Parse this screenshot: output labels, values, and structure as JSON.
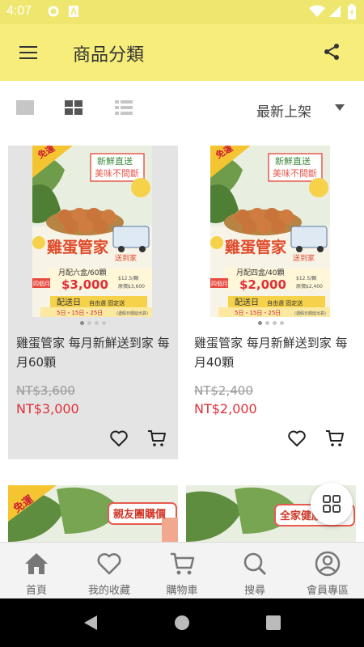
{
  "status_bar": {
    "time": "4:07"
  },
  "app_bar": {
    "title": "商品分類"
  },
  "toolbar": {
    "sort_label": "最新上架"
  },
  "products": [
    {
      "name": "雞蛋管家 每月新鮮送到家 每月60顆",
      "original_price": "NT$3,600",
      "price": "NT$3,000",
      "image": {
        "badge": "免運",
        "slogan_1": "新鮮直送",
        "slogan_2": "美味不間斷",
        "brand": "雞蛋管家",
        "brand_sub": "送到家",
        "plan": "月配六盒/60顆",
        "period": "四個月",
        "promo_price": "$3,000",
        "unit_price": "$12.5/顆",
        "orig_note": "原價$3,600",
        "delivery": "配送日",
        "delivery_opts": "自由選 固定送",
        "dates": "5日・15日・25日",
        "dates_note": "(遇假日順延出貨)"
      }
    },
    {
      "name": "雞蛋管家 每月新鮮送到家 每月40顆",
      "original_price": "NT$2,400",
      "price": "NT$2,000",
      "image": {
        "badge": "免運",
        "slogan_1": "新鮮直送",
        "slogan_2": "美味不間斷",
        "brand": "雞蛋管家",
        "brand_sub": "送到家",
        "plan": "月配四盒/40顆",
        "period": "四個月",
        "promo_price": "$2,000",
        "unit_price": "$12.5/顆",
        "orig_note": "原價$2,400",
        "delivery": "配送日",
        "delivery_opts": "自由選 固定送",
        "dates": "5日・15日・25日",
        "dates_note": "(遇假日順延出貨)"
      }
    }
  ],
  "peek_cards": [
    {
      "badge": "免運",
      "tag": "親友團購價"
    },
    {
      "tag": "全家健康"
    }
  ],
  "bottom_nav": [
    {
      "label": "首頁",
      "icon": "home-icon"
    },
    {
      "label": "我的收藏",
      "icon": "heart-icon"
    },
    {
      "label": "購物車",
      "icon": "cart-icon"
    },
    {
      "label": "搜尋",
      "icon": "search-icon"
    },
    {
      "label": "會員專區",
      "icon": "account-icon"
    }
  ],
  "colors": {
    "app_bar": "#f6ed7b",
    "status_bar": "#efe66f",
    "price_red": "#e0303a",
    "selected_card": "#e4e4e4"
  }
}
